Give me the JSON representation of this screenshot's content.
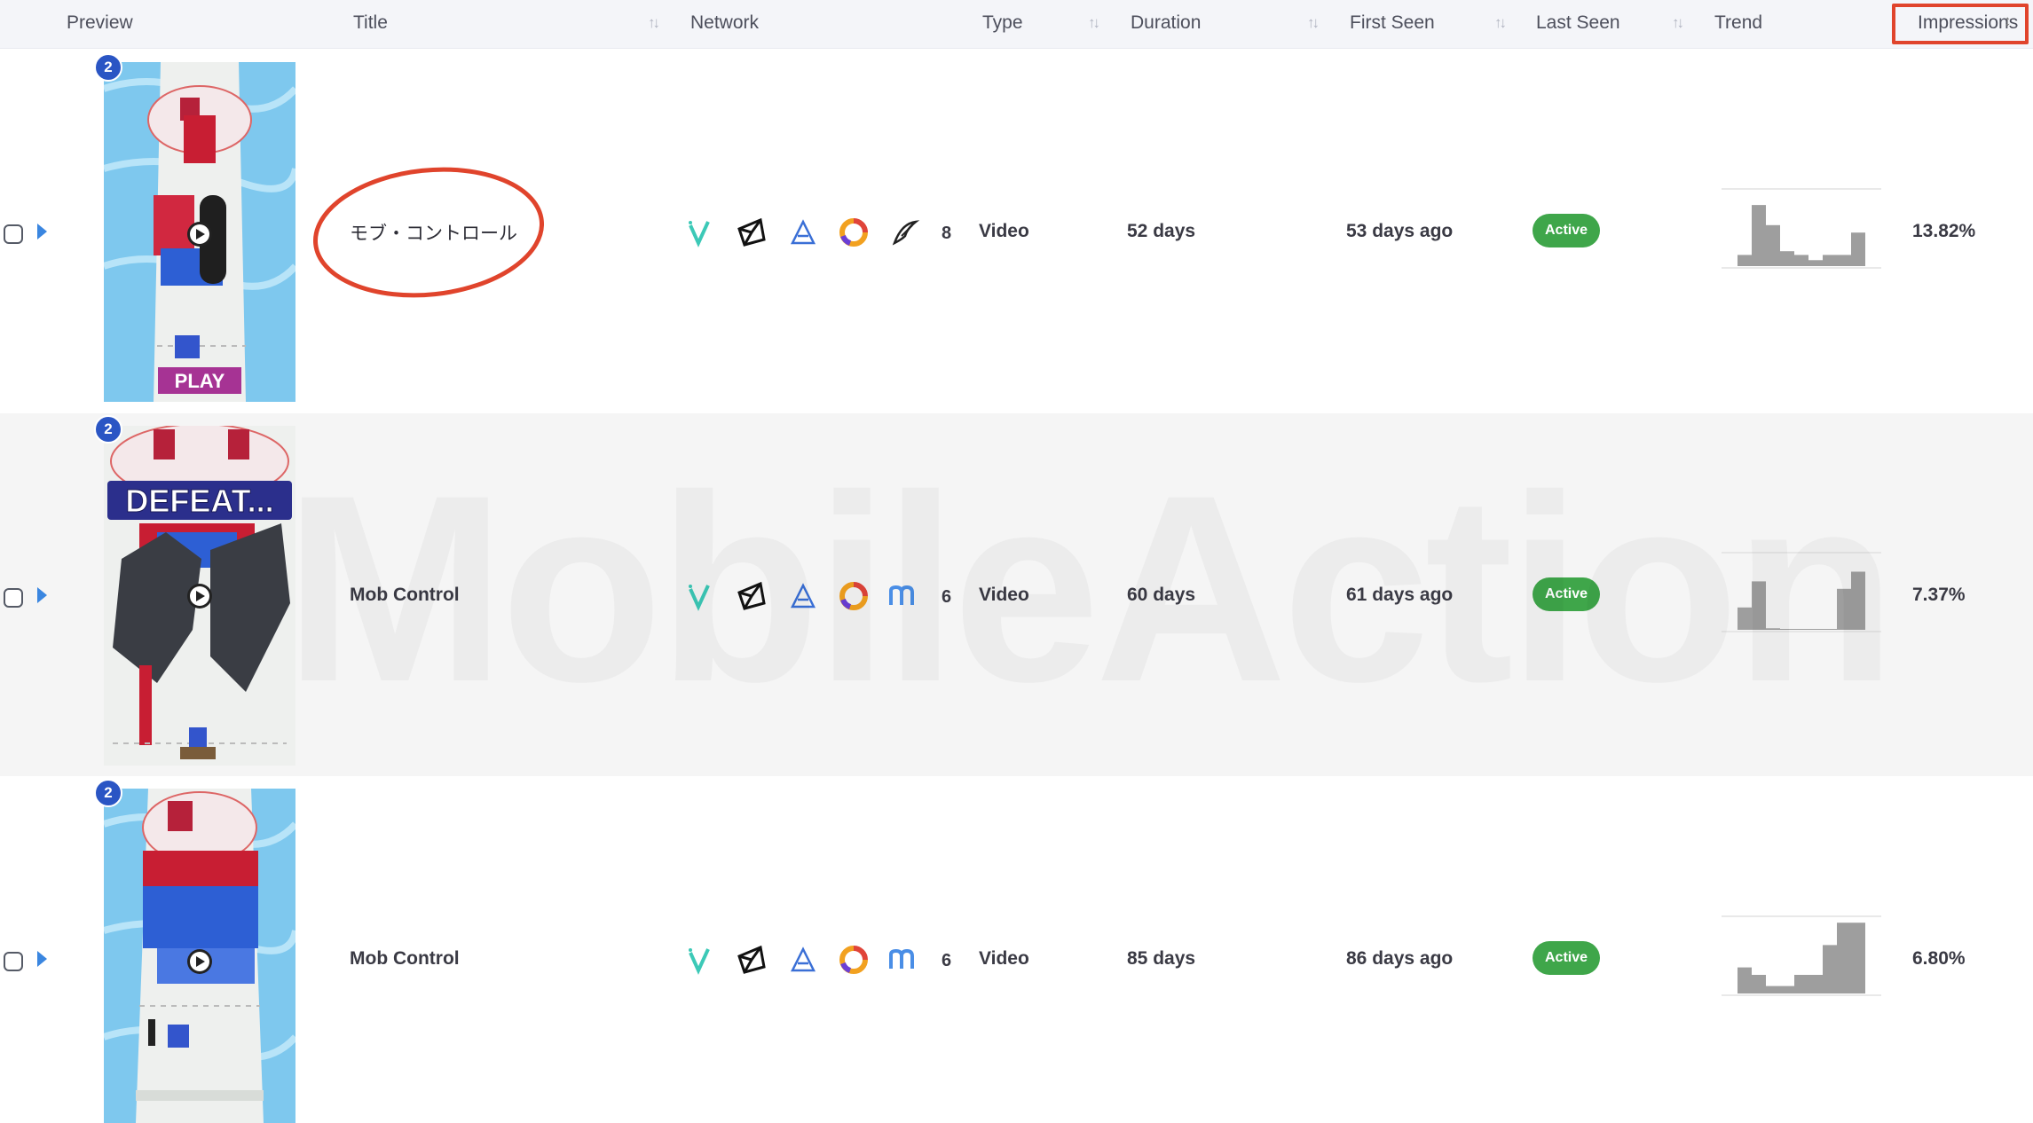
{
  "header": {
    "preview": "Preview",
    "title": "Title",
    "network": "Network",
    "type": "Type",
    "duration": "Duration",
    "first_seen": "First Seen",
    "last_seen": "Last Seen",
    "trend": "Trend",
    "impressions": "Impressions"
  },
  "watermark": "MobileAction",
  "rows": [
    {
      "badge": "2",
      "thumb_label": "PLAY",
      "title": "モブ・コントロール",
      "network_count": "8",
      "type": "Video",
      "duration": "52 days",
      "first_seen": "53 days ago",
      "status": "Active",
      "impressions": "13.82%",
      "trend": [
        0.15,
        0.82,
        0.55,
        0.2,
        0.15,
        0.08,
        0.15,
        0.15,
        0.45
      ]
    },
    {
      "badge": "2",
      "thumb_label": "DEFEAT...",
      "title": "Mob Control",
      "network_count": "6",
      "type": "Video",
      "duration": "60 days",
      "first_seen": "61 days ago",
      "status": "Active",
      "impressions": "7.37%",
      "trend": [
        0.3,
        0.65,
        0.02,
        0.0,
        0.0,
        0.0,
        0.0,
        0.55,
        0.78
      ]
    },
    {
      "badge": "2",
      "thumb_label": "",
      "title": "Mob Control",
      "network_count": "6",
      "type": "Video",
      "duration": "85 days",
      "first_seen": "86 days ago",
      "status": "Active",
      "impressions": "6.80%",
      "trend": [
        0.35,
        0.25,
        0.1,
        0.1,
        0.25,
        0.25,
        0.65,
        0.95,
        0.95
      ]
    }
  ],
  "network_icons_row1": [
    "vungle-icon",
    "unity-icon",
    "applovin-icon",
    "google-ads-icon",
    "ironsource-icon"
  ],
  "network_icons_row23": [
    "vungle-icon",
    "unity-icon",
    "applovin-icon",
    "google-ads-icon",
    "mintegral-icon"
  ],
  "colors": {
    "accent": "#3a86e0",
    "active": "#3fa64a",
    "highlight": "#e0442c",
    "badge": "#2a55c4",
    "bar": "#9e9e9e"
  }
}
